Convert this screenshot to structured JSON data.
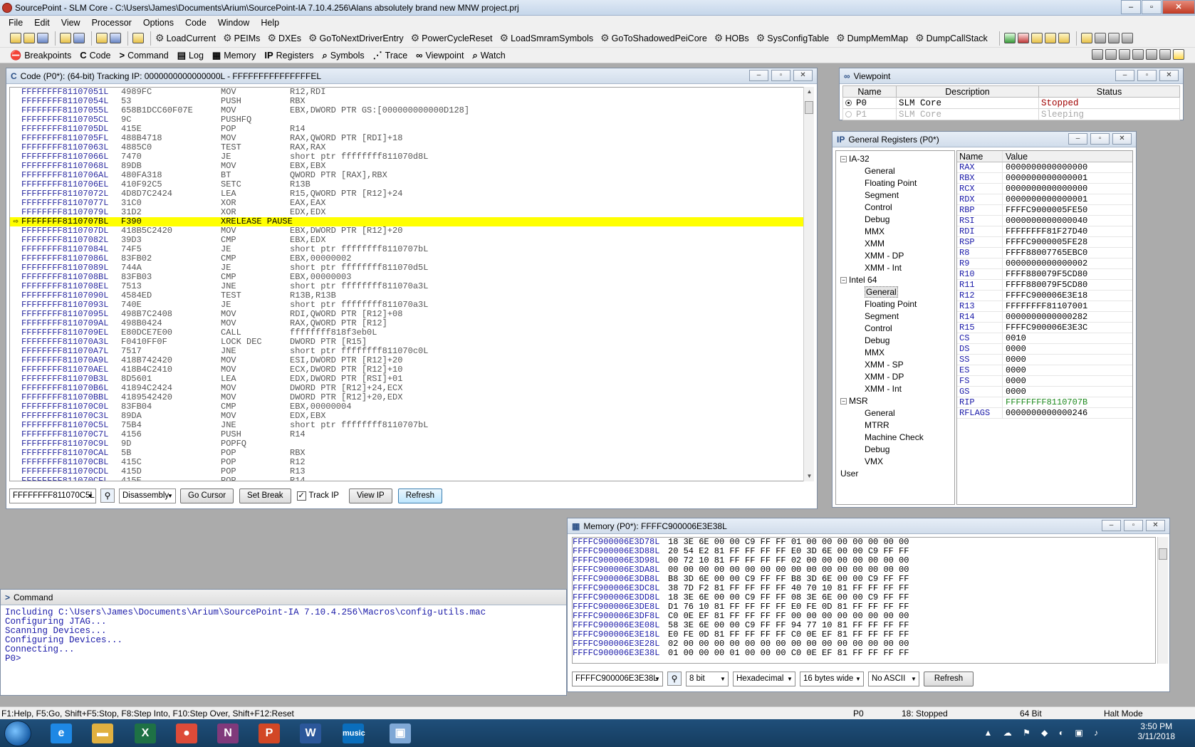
{
  "window": {
    "title": "SourcePoint - SLM Core - C:\\Users\\James\\Documents\\Arium\\SourcePoint-IA 7.10.4.256\\Alans absolutely brand new MNW project.prj",
    "controls": [
      "–",
      "▫",
      "✕"
    ]
  },
  "menu": [
    "File",
    "Edit",
    "View",
    "Processor",
    "Options",
    "Code",
    "Window",
    "Help"
  ],
  "macros": [
    "LoadCurrent",
    "PEIMs",
    "DXEs",
    "GoToNextDriverEntry",
    "PowerCycleReset",
    "LoadSmramSymbols",
    "GoToShadowedPeiCore",
    "HOBs",
    "SysConfigTable",
    "DumpMemMap",
    "DumpCallStack"
  ],
  "views": [
    {
      "label": "Breakpoints",
      "icon": "breakpoints-icon",
      "glyph": "⛔"
    },
    {
      "label": "Code",
      "icon": "code-icon",
      "glyph": "C"
    },
    {
      "label": "Command",
      "icon": "command-icon",
      "glyph": ">"
    },
    {
      "label": "Log",
      "icon": "log-icon",
      "glyph": "▤"
    },
    {
      "label": "Memory",
      "icon": "memory-icon",
      "glyph": "▦"
    },
    {
      "label": "Registers",
      "icon": "registers-icon",
      "glyph": "IP"
    },
    {
      "label": "Symbols",
      "icon": "symbols-icon",
      "glyph": "⌕"
    },
    {
      "label": "Trace",
      "icon": "trace-icon",
      "glyph": "⋰"
    },
    {
      "label": "Viewpoint",
      "icon": "viewpoint-icon",
      "glyph": "∞"
    },
    {
      "label": "Watch",
      "icon": "watch-icon",
      "glyph": "⌕"
    }
  ],
  "code": {
    "title": "Code (P0*): (64-bit) Tracking IP: 0000000000000000L - FFFFFFFFFFFFFFFEL",
    "highlight_index": 14,
    "rows": [
      [
        "FFFFFFFF81107051L",
        "4989FC",
        "MOV",
        "R12,RDI"
      ],
      [
        "FFFFFFFF81107054L",
        "53",
        "PUSH",
        "RBX"
      ],
      [
        "FFFFFFFF81107055L",
        "658B1DCC60F07E",
        "MOV",
        "EBX,DWORD PTR GS:[000000000000D128]"
      ],
      [
        "FFFFFFFF8110705CL",
        "9C",
        "PUSHFQ",
        ""
      ],
      [
        "FFFFFFFF8110705DL",
        "415E",
        "POP",
        "R14"
      ],
      [
        "FFFFFFFF8110705FL",
        "488B4718",
        "MOV",
        "RAX,QWORD PTR [RDI]+18"
      ],
      [
        "FFFFFFFF81107063L",
        "4885C0",
        "TEST",
        "RAX,RAX"
      ],
      [
        "FFFFFFFF81107066L",
        "7470",
        "JE",
        "short ptr ffffffff811070d8L"
      ],
      [
        "FFFFFFFF81107068L",
        "89DB",
        "MOV",
        "EBX,EBX"
      ],
      [
        "FFFFFFFF8110706AL",
        "480FA318",
        "BT",
        "QWORD PTR [RAX],RBX"
      ],
      [
        "FFFFFFFF8110706EL",
        "410F92C5",
        "SETC",
        "R13B"
      ],
      [
        "FFFFFFFF81107072L",
        "4D8D7C2424",
        "LEA",
        "R15,QWORD PTR [R12]+24"
      ],
      [
        "FFFFFFFF81107077L",
        "31C0",
        "XOR",
        "EAX,EAX"
      ],
      [
        "FFFFFFFF81107079L",
        "31D2",
        "XOR",
        "EDX,EDX"
      ],
      [
        "FFFFFFFF8110707BL",
        "F390",
        "XRELEASE PAUSE",
        ""
      ],
      [
        "FFFFFFFF8110707DL",
        "418B5C2420",
        "MOV",
        "EBX,DWORD PTR [R12]+20"
      ],
      [
        "FFFFFFFF81107082L",
        "39D3",
        "CMP",
        "EBX,EDX"
      ],
      [
        "FFFFFFFF81107084L",
        "74F5",
        "JE",
        "short ptr ffffffff8110707bL"
      ],
      [
        "FFFFFFFF81107086L",
        "83FB02",
        "CMP",
        "EBX,00000002"
      ],
      [
        "FFFFFFFF81107089L",
        "744A",
        "JE",
        "short ptr ffffffff811070d5L"
      ],
      [
        "FFFFFFFF8110708BL",
        "83FB03",
        "CMP",
        "EBX,00000003"
      ],
      [
        "FFFFFFFF8110708EL",
        "7513",
        "JNE",
        "short ptr ffffffff811070a3L"
      ],
      [
        "FFFFFFFF81107090L",
        "4584ED",
        "TEST",
        "R13B,R13B"
      ],
      [
        "FFFFFFFF81107093L",
        "740E",
        "JE",
        "short ptr ffffffff811070a3L"
      ],
      [
        "FFFFFFFF81107095L",
        "498B7C2408",
        "MOV",
        "RDI,QWORD PTR [R12]+08"
      ],
      [
        "FFFFFFFF8110709AL",
        "498B0424",
        "MOV",
        "RAX,QWORD PTR [R12]"
      ],
      [
        "FFFFFFFF8110709EL",
        "E80DCE7E00",
        "CALL",
        "ffffffff818f3eb0L"
      ],
      [
        "FFFFFFFF811070A3L",
        "F0410FF0F",
        "LOCK DEC",
        "DWORD PTR [R15]"
      ],
      [
        "FFFFFFFF811070A7L",
        "7517",
        "JNE",
        "short ptr ffffffff811070c0L"
      ],
      [
        "FFFFFFFF811070A9L",
        "418B742420",
        "MOV",
        "ESI,DWORD PTR [R12]+20"
      ],
      [
        "FFFFFFFF811070AEL",
        "418B4C2410",
        "MOV",
        "ECX,DWORD PTR [R12]+10"
      ],
      [
        "FFFFFFFF811070B3L",
        "8D5601",
        "LEA",
        "EDX,DWORD PTR [RSI]+01"
      ],
      [
        "FFFFFFFF811070B6L",
        "41894C2424",
        "MOV",
        "DWORD PTR [R12]+24,ECX"
      ],
      [
        "FFFFFFFF811070BBL",
        "4189542420",
        "MOV",
        "DWORD PTR [R12]+20,EDX"
      ],
      [
        "FFFFFFFF811070C0L",
        "83FB04",
        "CMP",
        "EBX,00000004"
      ],
      [
        "FFFFFFFF811070C3L",
        "89DA",
        "MOV",
        "EDX,EBX"
      ],
      [
        "FFFFFFFF811070C5L",
        "75B4",
        "JNE",
        "short ptr ffffffff8110707bL"
      ],
      [
        "FFFFFFFF811070C7L",
        "4156",
        "PUSH",
        "R14"
      ],
      [
        "FFFFFFFF811070C9L",
        "9D",
        "POPFQ",
        ""
      ],
      [
        "FFFFFFFF811070CAL",
        "5B",
        "POP",
        "RBX"
      ],
      [
        "FFFFFFFF811070CBL",
        "415C",
        "POP",
        "R12"
      ],
      [
        "FFFFFFFF811070CDL",
        "415D",
        "POP",
        "R13"
      ],
      [
        "FFFFFFFF811070CFL",
        "415E",
        "POP",
        "R14"
      ]
    ],
    "address_value": "FFFFFFFF811070C5L",
    "mode_value": "Disassembly",
    "go_cursor": "Go Cursor",
    "set_break": "Set Break",
    "track_ip": "Track IP",
    "view_ip": "View IP",
    "refresh": "Refresh"
  },
  "viewpoint": {
    "title": "Viewpoint",
    "headers": [
      "Name",
      "Description",
      "Status"
    ],
    "rows": [
      {
        "name": "P0",
        "desc": "SLM Core",
        "status": "Stopped",
        "active": true
      },
      {
        "name": "P1",
        "desc": "SLM Core",
        "status": "Sleeping",
        "active": false
      }
    ]
  },
  "registers": {
    "title": "General Registers (P0*)",
    "tree": [
      {
        "label": "IA-32",
        "level": 0,
        "expander": "−"
      },
      {
        "label": "General",
        "level": 1
      },
      {
        "label": "Floating Point",
        "level": 1
      },
      {
        "label": "Segment",
        "level": 1
      },
      {
        "label": "Control",
        "level": 1
      },
      {
        "label": "Debug",
        "level": 1
      },
      {
        "label": "MMX",
        "level": 1
      },
      {
        "label": "XMM",
        "level": 1
      },
      {
        "label": "XMM - DP",
        "level": 1
      },
      {
        "label": "XMM - Int",
        "level": 1
      },
      {
        "label": "Intel 64",
        "level": 0,
        "expander": "−"
      },
      {
        "label": "General",
        "level": 1,
        "selected": true
      },
      {
        "label": "Floating Point",
        "level": 1
      },
      {
        "label": "Segment",
        "level": 1
      },
      {
        "label": "Control",
        "level": 1
      },
      {
        "label": "Debug",
        "level": 1
      },
      {
        "label": "MMX",
        "level": 1
      },
      {
        "label": "XMM - SP",
        "level": 1
      },
      {
        "label": "XMM - DP",
        "level": 1
      },
      {
        "label": "XMM - Int",
        "level": 1
      },
      {
        "label": "MSR",
        "level": 0,
        "expander": "−"
      },
      {
        "label": "General",
        "level": 1
      },
      {
        "label": "MTRR",
        "level": 1
      },
      {
        "label": "Machine Check",
        "level": 1
      },
      {
        "label": "Debug",
        "level": 1
      },
      {
        "label": "VMX",
        "level": 1
      },
      {
        "label": "User",
        "level": 0
      }
    ],
    "headers": [
      "Name",
      "Value"
    ],
    "rows": [
      [
        "RAX",
        "0000000000000000"
      ],
      [
        "RBX",
        "0000000000000001"
      ],
      [
        "RCX",
        "0000000000000000"
      ],
      [
        "RDX",
        "0000000000000001"
      ],
      [
        "RBP",
        "FFFFC9000005FE50"
      ],
      [
        "RSI",
        "0000000000000040"
      ],
      [
        "RDI",
        "FFFFFFFF81F27D40"
      ],
      [
        "RSP",
        "FFFFC9000005FE28"
      ],
      [
        "R8",
        "FFFF88007765EBC0"
      ],
      [
        "R9",
        "0000000000000002"
      ],
      [
        "R10",
        "FFFF880079F5CD80"
      ],
      [
        "R11",
        "FFFF880079F5CD80"
      ],
      [
        "R12",
        "FFFFC900006E3E18"
      ],
      [
        "R13",
        "FFFFFFFF81107001"
      ],
      [
        "R14",
        "0000000000000282"
      ],
      [
        "R15",
        "FFFFC900006E3E3C"
      ],
      [
        "CS",
        "0010"
      ],
      [
        "DS",
        "0000"
      ],
      [
        "SS",
        "0000"
      ],
      [
        "ES",
        "0000"
      ],
      [
        "FS",
        "0000"
      ],
      [
        "GS",
        "0000"
      ],
      [
        "RIP",
        "FFFFFFFF8110707B"
      ],
      [
        "RFLAGS",
        "0000000000000246"
      ]
    ],
    "changed_color": "#1f8a1f"
  },
  "memory": {
    "title": "Memory (P0*): FFFFC900006E3E38L",
    "rows": [
      [
        "FFFFC900006E3D78L",
        "18 3E 6E 00 00 C9 FF FF 01 00 00 00 00 00 00 00"
      ],
      [
        "FFFFC900006E3D88L",
        "20 54 E2 81 FF FF FF FF E0 3D 6E 00 00 C9 FF FF"
      ],
      [
        "FFFFC900006E3D98L",
        "00 72 10 81 FF FF FF FF 02 00 00 00 00 00 00 00"
      ],
      [
        "FFFFC900006E3DA8L",
        "00 00 00 00 00 00 00 00 00 00 00 00 00 00 00 00"
      ],
      [
        "FFFFC900006E3DB8L",
        "B8 3D 6E 00 00 C9 FF FF B8 3D 6E 00 00 C9 FF FF"
      ],
      [
        "FFFFC900006E3DC8L",
        "38 7D F2 81 FF FF FF FF 40 70 10 81 FF FF FF FF"
      ],
      [
        "FFFFC900006E3DD8L",
        "18 3E 6E 00 00 C9 FF FF 08 3E 6E 00 00 C9 FF FF"
      ],
      [
        "FFFFC900006E3DE8L",
        "D1 76 10 81 FF FF FF FF E0 FE 0D 81 FF FF FF FF"
      ],
      [
        "FFFFC900006E3DF8L",
        "C0 0E EF 81 FF FF FF FF 00 00 00 00 00 00 00 00"
      ],
      [
        "FFFFC900006E3E08L",
        "58 3E 6E 00 00 C9 FF FF 94 77 10 81 FF FF FF FF"
      ],
      [
        "FFFFC900006E3E18L",
        "E0 FE 0D 81 FF FF FF FF C0 0E EF 81 FF FF FF FF"
      ],
      [
        "FFFFC900006E3E28L",
        "02 00 00 00 00 00 00 00 00 00 00 00 00 00 00 00"
      ],
      [
        "FFFFC900006E3E38L",
        "01 00 00 00 01 00 00 00 C0 0E EF 81 FF FF FF FF"
      ]
    ],
    "address_value": "FFFFC900006E3E38L",
    "width_value": "8 bit",
    "format_value": "Hexadecimal",
    "bytes_wide_value": "16 bytes wide",
    "ascii_value": "No ASCII",
    "refresh": "Refresh"
  },
  "command": {
    "title": "Command",
    "lines": [
      "Including C:\\Users\\James\\Documents\\Arium\\SourcePoint-IA 7.10.4.256\\Macros\\config-utils.mac",
      "Configuring JTAG...",
      "Scanning Devices...",
      "Configuring Devices...",
      "Connecting...",
      "P0>"
    ]
  },
  "status": {
    "help": "F1:Help, F5:Go, Shift+F5:Stop, F8:Step Into, F10:Step Over, Shift+F12:Reset",
    "processor": "P0",
    "state": "18: Stopped",
    "bits": "64 Bit",
    "mode": "Halt Mode"
  },
  "taskbar": {
    "time": "3:50 PM",
    "date": "3/11/2018",
    "apps": [
      {
        "name": "taskbar-internet-explorer",
        "glyph": "e",
        "color": "#1e88e5"
      },
      {
        "name": "taskbar-file-explorer",
        "glyph": "▬",
        "color": "#e0b040"
      },
      {
        "name": "taskbar-excel",
        "glyph": "X",
        "color": "#1e7145"
      },
      {
        "name": "taskbar-chrome",
        "glyph": "●",
        "color": "#dd4b39"
      },
      {
        "name": "taskbar-onenote",
        "glyph": "N",
        "color": "#80397b"
      },
      {
        "name": "taskbar-powerpoint",
        "glyph": "P",
        "color": "#d24726"
      },
      {
        "name": "taskbar-word",
        "glyph": "W",
        "color": "#2b579a"
      },
      {
        "name": "taskbar-amazon-music",
        "glyph": "music",
        "color": "#0a6ebd"
      },
      {
        "name": "taskbar-sourcepoint",
        "glyph": "▣",
        "color": "#7fa8d6"
      }
    ]
  }
}
